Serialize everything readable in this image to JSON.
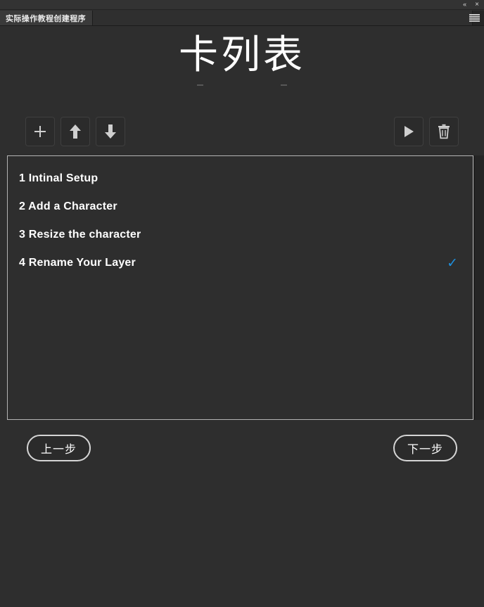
{
  "window": {
    "collapse_label": "«",
    "close_label": "×",
    "menu_icon": "hamburger-icon"
  },
  "tabs": [
    {
      "label": "实际操作教程创建程序",
      "active": true
    }
  ],
  "header": {
    "title": "卡列表"
  },
  "toolbar": {
    "left": [
      {
        "name": "add-button",
        "icon": "plus-icon",
        "label": "+"
      },
      {
        "name": "move-up-button",
        "icon": "arrow-up-icon",
        "label": "↑"
      },
      {
        "name": "move-down-button",
        "icon": "arrow-down-icon",
        "label": "↓"
      }
    ],
    "right": [
      {
        "name": "play-button",
        "icon": "play-icon",
        "label": "▶"
      },
      {
        "name": "delete-button",
        "icon": "trash-icon",
        "label": "🗑"
      }
    ]
  },
  "list": {
    "items": [
      {
        "index": "1",
        "title": "1 Intinal Setup",
        "checked": false,
        "check_mark": "✓"
      },
      {
        "index": "2",
        "title": "2 Add a Character",
        "checked": false,
        "check_mark": "✓"
      },
      {
        "index": "3",
        "title": "3 Resize the character",
        "checked": false,
        "check_mark": "✓"
      },
      {
        "index": "4",
        "title": "4 Rename Your Layer",
        "checked": true,
        "check_mark": "✓"
      }
    ]
  },
  "footer": {
    "prev_label": "上一步",
    "next_label": "下一步"
  },
  "colors": {
    "background": "#2e2e2e",
    "panel_border": "#b4b4b4",
    "accent_check": "#1e90dd",
    "tab_active": "#3a3a3a",
    "icon": "#cfcfcf"
  }
}
